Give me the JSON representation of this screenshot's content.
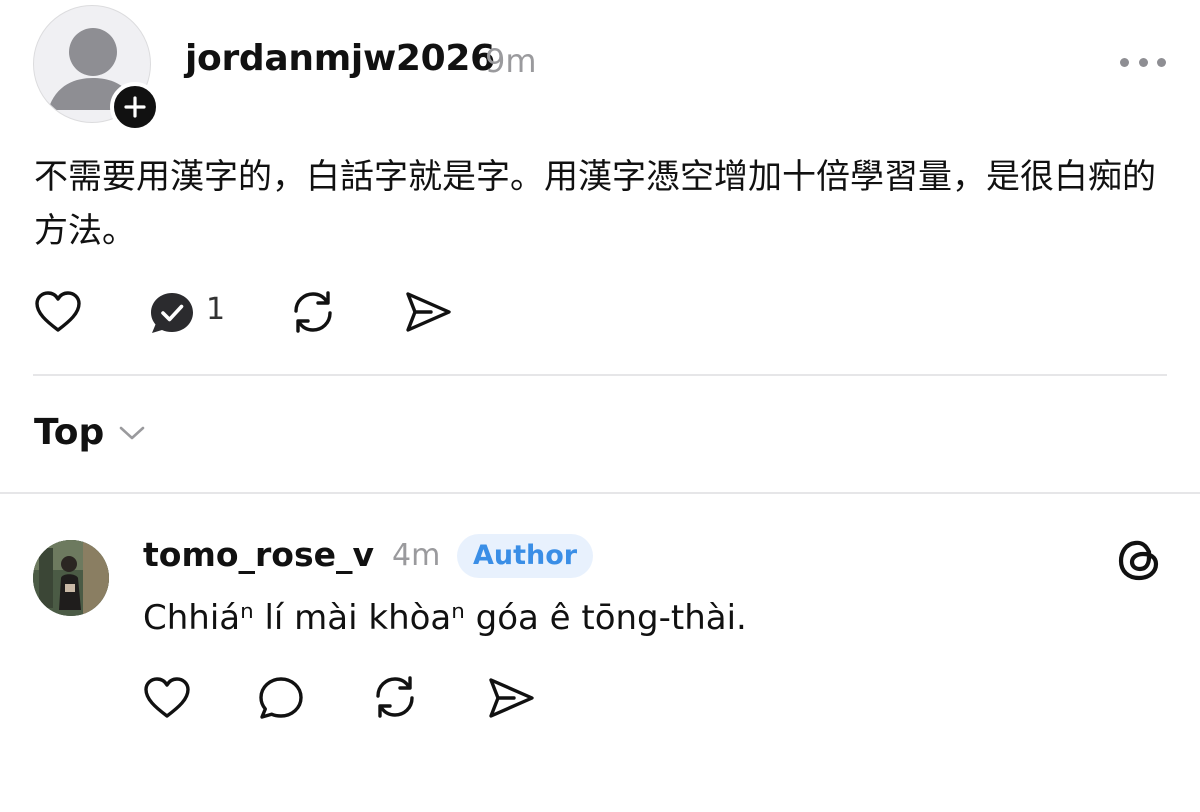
{
  "post": {
    "username": "jordanmjw2026",
    "time": "9m",
    "text": "不需要用漢字的，白話字就是字。用漢字憑空增加十倍學習量，是很白痴的方法。",
    "reply_count": "1",
    "icons": [
      "avatar-placeholder-icon",
      "plus-icon",
      "more-icon",
      "heart-icon",
      "reply-icon",
      "repost-icon",
      "share-icon"
    ]
  },
  "sort": {
    "label": "Top"
  },
  "reply": {
    "username": "tomo_rose_v",
    "time": "4m",
    "badge": "Author",
    "text": "Chhiáⁿ lí mài khòaⁿ góa ê tōng-thài.",
    "icons": [
      "heart-icon",
      "comment-icon",
      "repost-icon",
      "share-icon",
      "threads-logo-icon"
    ]
  },
  "colors": {
    "text": "#111111",
    "muted": "#9a9a9d",
    "badge_bg": "#e8f1fd",
    "badge_text": "#3a8ee6",
    "divider": "#e6e6e8"
  }
}
